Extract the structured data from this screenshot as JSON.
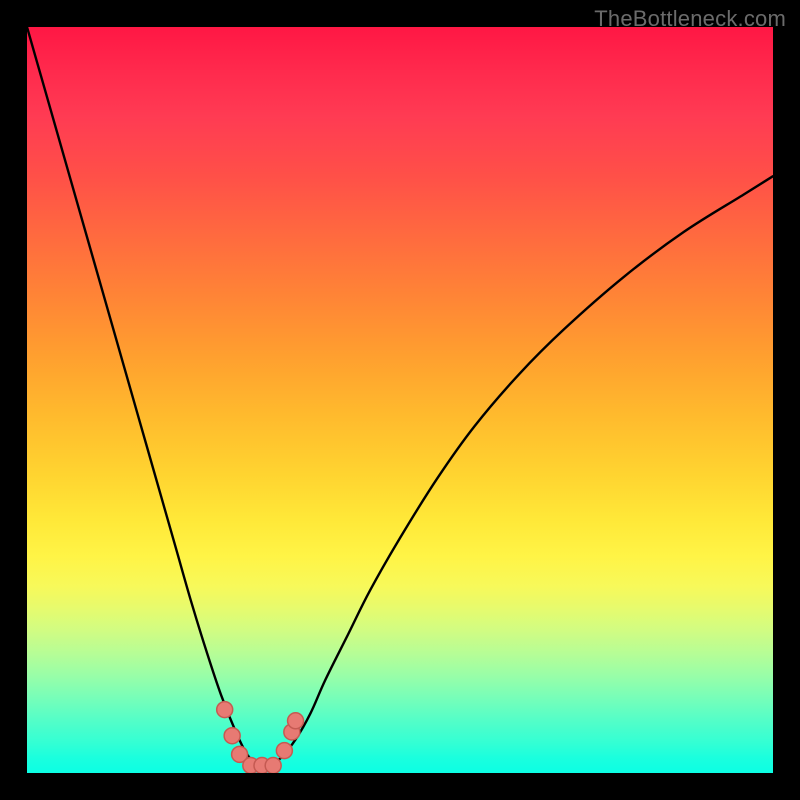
{
  "watermark": "TheBottleneck.com",
  "chart_data": {
    "type": "line",
    "title": "",
    "xlabel": "",
    "ylabel": "",
    "x": [
      0.0,
      0.02,
      0.04,
      0.06,
      0.08,
      0.1,
      0.12,
      0.14,
      0.16,
      0.18,
      0.2,
      0.22,
      0.24,
      0.26,
      0.28,
      0.295,
      0.31,
      0.325,
      0.34,
      0.36,
      0.38,
      0.4,
      0.43,
      0.46,
      0.5,
      0.55,
      0.6,
      0.66,
      0.72,
      0.8,
      0.88,
      0.96,
      1.0
    ],
    "values": [
      1.0,
      0.93,
      0.86,
      0.79,
      0.72,
      0.65,
      0.58,
      0.51,
      0.44,
      0.37,
      0.3,
      0.23,
      0.165,
      0.105,
      0.055,
      0.025,
      0.01,
      0.01,
      0.02,
      0.045,
      0.08,
      0.125,
      0.185,
      0.245,
      0.315,
      0.395,
      0.465,
      0.535,
      0.595,
      0.665,
      0.725,
      0.775,
      0.8
    ],
    "xlim": [
      0,
      1
    ],
    "ylim": [
      0,
      1
    ],
    "markers": {
      "x": [
        0.265,
        0.275,
        0.285,
        0.3,
        0.315,
        0.33,
        0.345,
        0.355,
        0.36
      ],
      "y": [
        0.085,
        0.05,
        0.025,
        0.01,
        0.01,
        0.01,
        0.03,
        0.055,
        0.07
      ]
    },
    "background_gradient": {
      "top_color": "#ff1744",
      "mid_color": "#fff446",
      "bottom_color": "#0cffe4"
    }
  }
}
